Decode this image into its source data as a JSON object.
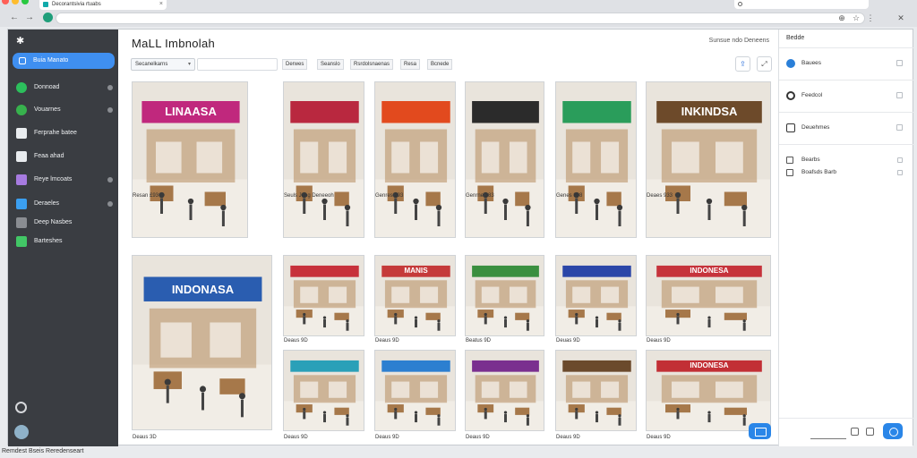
{
  "browser": {
    "tab_title": "Decorantsivia rtuabs",
    "address": "",
    "traffic_lights": [
      "#ff5f57",
      "#febc2e",
      "#28c840"
    ]
  },
  "sidebar": {
    "active_label": "Buia Manato",
    "items": [
      {
        "label": "Donnoad",
        "icon": "circle-badge-icon",
        "color": "#2cbf5c"
      },
      {
        "label": "Vouarnes",
        "icon": "grid-icon",
        "color": "#37b24d"
      },
      {
        "label": "Ferprahe batee",
        "icon": "message-icon",
        "color": "#e9ecef"
      },
      {
        "label": "Feaa ahad",
        "icon": "calendar-icon",
        "color": "#e9ecef"
      },
      {
        "label": "Reye lmcoats",
        "icon": "profile-icon",
        "color": "#a77be0"
      },
      {
        "label": "Deraeles",
        "icon": "link-icon",
        "color": "#3b9ff0"
      },
      {
        "label": "Deep Nasbes",
        "icon": "tag-icon",
        "color": "#8a8d92"
      },
      {
        "label": "Barteshes",
        "icon": "apps-icon",
        "color": "#42c766"
      }
    ]
  },
  "main": {
    "title": "MaLL Imbnolah",
    "top_right": "Sunsue ndo Deneens",
    "filter_select": "Secanelkarns",
    "chips": [
      "Derwes",
      "Seanslo",
      "Rsrdolsnaenas",
      "Resa",
      "Bcnede"
    ],
    "cards": [
      {
        "caption": "Resan £93",
        "sign": "LINAASA",
        "accent": "#c0287d"
      },
      {
        "caption": "Seuls Jeng Deneeoh",
        "sign": "",
        "accent": "#b9283f"
      },
      {
        "caption": "Genres 293",
        "sign": "",
        "accent": "#e24a1e"
      },
      {
        "caption": "Genrne 383",
        "sign": "",
        "accent": "#2b2b2b"
      },
      {
        "caption": "Genes 898",
        "sign": "",
        "accent": "#2a9d5b"
      },
      {
        "caption": "Deaes 933",
        "sign": "INKINDSA",
        "accent": "#6d4a2a"
      },
      {
        "caption": "Deaus 3D",
        "sign": "INDONASA",
        "accent": "#2a5db0"
      },
      {
        "caption": "Deaus 9D",
        "sign": "",
        "accent": "#c7313b"
      },
      {
        "caption": "Deaus 9D",
        "sign": "MANIS",
        "accent": "#c53a3a"
      },
      {
        "caption": "Beatus 9D",
        "sign": "",
        "accent": "#3a8f3f"
      },
      {
        "caption": "Deuas 9D",
        "sign": "",
        "accent": "#2b46a8"
      },
      {
        "caption": "Deaus 9D",
        "sign": "INDONESA",
        "accent": "#c6333b"
      },
      {
        "caption": "Deaus 9D",
        "sign": "",
        "accent": "#2aa0b8"
      },
      {
        "caption": "Deaus 9D",
        "sign": "",
        "accent": "#2c7fd0"
      },
      {
        "caption": "Deaus 9D",
        "sign": "",
        "accent": "#7a2f8f"
      },
      {
        "caption": "Deaus 9D",
        "sign": "",
        "accent": "#6b4a2c"
      },
      {
        "caption": "Deaus 9D",
        "sign": "INDONESA",
        "accent": "#c22f35"
      }
    ]
  },
  "right_panel": {
    "title": "Bedde",
    "rows": [
      {
        "label": "Bauees",
        "icon": "location-icon"
      },
      {
        "label": "Feedcol",
        "icon": "refresh-icon"
      },
      {
        "label": "Deuehmes",
        "icon": "notes-icon"
      }
    ],
    "subs": [
      {
        "label": "Bearbs",
        "icon": "grid-small-icon"
      },
      {
        "label": "Boafsds Barb",
        "icon": "gallery-icon"
      }
    ]
  },
  "status_bar": "Remdest Bseis Reredenseart"
}
